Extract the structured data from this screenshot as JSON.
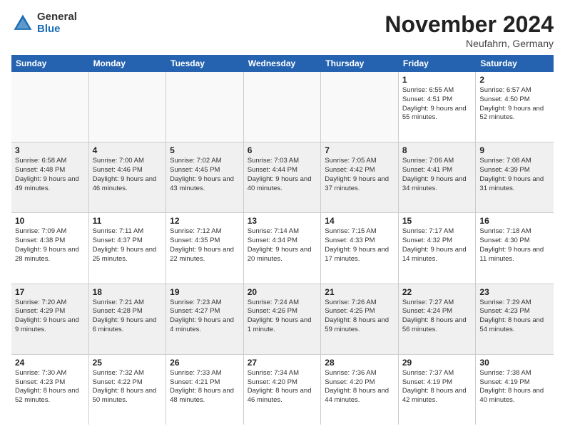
{
  "logo": {
    "general": "General",
    "blue": "Blue"
  },
  "title": "November 2024",
  "location": "Neufahrn, Germany",
  "header": {
    "days": [
      "Sunday",
      "Monday",
      "Tuesday",
      "Wednesday",
      "Thursday",
      "Friday",
      "Saturday"
    ]
  },
  "weeks": [
    [
      {
        "day": "",
        "info": "",
        "empty": true
      },
      {
        "day": "",
        "info": "",
        "empty": true
      },
      {
        "day": "",
        "info": "",
        "empty": true
      },
      {
        "day": "",
        "info": "",
        "empty": true
      },
      {
        "day": "",
        "info": "",
        "empty": true
      },
      {
        "day": "1",
        "info": "Sunrise: 6:55 AM\nSunset: 4:51 PM\nDaylight: 9 hours and 55 minutes."
      },
      {
        "day": "2",
        "info": "Sunrise: 6:57 AM\nSunset: 4:50 PM\nDaylight: 9 hours and 52 minutes."
      }
    ],
    [
      {
        "day": "3",
        "info": "Sunrise: 6:58 AM\nSunset: 4:48 PM\nDaylight: 9 hours and 49 minutes."
      },
      {
        "day": "4",
        "info": "Sunrise: 7:00 AM\nSunset: 4:46 PM\nDaylight: 9 hours and 46 minutes."
      },
      {
        "day": "5",
        "info": "Sunrise: 7:02 AM\nSunset: 4:45 PM\nDaylight: 9 hours and 43 minutes."
      },
      {
        "day": "6",
        "info": "Sunrise: 7:03 AM\nSunset: 4:44 PM\nDaylight: 9 hours and 40 minutes."
      },
      {
        "day": "7",
        "info": "Sunrise: 7:05 AM\nSunset: 4:42 PM\nDaylight: 9 hours and 37 minutes."
      },
      {
        "day": "8",
        "info": "Sunrise: 7:06 AM\nSunset: 4:41 PM\nDaylight: 9 hours and 34 minutes."
      },
      {
        "day": "9",
        "info": "Sunrise: 7:08 AM\nSunset: 4:39 PM\nDaylight: 9 hours and 31 minutes."
      }
    ],
    [
      {
        "day": "10",
        "info": "Sunrise: 7:09 AM\nSunset: 4:38 PM\nDaylight: 9 hours and 28 minutes."
      },
      {
        "day": "11",
        "info": "Sunrise: 7:11 AM\nSunset: 4:37 PM\nDaylight: 9 hours and 25 minutes."
      },
      {
        "day": "12",
        "info": "Sunrise: 7:12 AM\nSunset: 4:35 PM\nDaylight: 9 hours and 22 minutes."
      },
      {
        "day": "13",
        "info": "Sunrise: 7:14 AM\nSunset: 4:34 PM\nDaylight: 9 hours and 20 minutes."
      },
      {
        "day": "14",
        "info": "Sunrise: 7:15 AM\nSunset: 4:33 PM\nDaylight: 9 hours and 17 minutes."
      },
      {
        "day": "15",
        "info": "Sunrise: 7:17 AM\nSunset: 4:32 PM\nDaylight: 9 hours and 14 minutes."
      },
      {
        "day": "16",
        "info": "Sunrise: 7:18 AM\nSunset: 4:30 PM\nDaylight: 9 hours and 11 minutes."
      }
    ],
    [
      {
        "day": "17",
        "info": "Sunrise: 7:20 AM\nSunset: 4:29 PM\nDaylight: 9 hours and 9 minutes."
      },
      {
        "day": "18",
        "info": "Sunrise: 7:21 AM\nSunset: 4:28 PM\nDaylight: 9 hours and 6 minutes."
      },
      {
        "day": "19",
        "info": "Sunrise: 7:23 AM\nSunset: 4:27 PM\nDaylight: 9 hours and 4 minutes."
      },
      {
        "day": "20",
        "info": "Sunrise: 7:24 AM\nSunset: 4:26 PM\nDaylight: 9 hours and 1 minute."
      },
      {
        "day": "21",
        "info": "Sunrise: 7:26 AM\nSunset: 4:25 PM\nDaylight: 8 hours and 59 minutes."
      },
      {
        "day": "22",
        "info": "Sunrise: 7:27 AM\nSunset: 4:24 PM\nDaylight: 8 hours and 56 minutes."
      },
      {
        "day": "23",
        "info": "Sunrise: 7:29 AM\nSunset: 4:23 PM\nDaylight: 8 hours and 54 minutes."
      }
    ],
    [
      {
        "day": "24",
        "info": "Sunrise: 7:30 AM\nSunset: 4:23 PM\nDaylight: 8 hours and 52 minutes."
      },
      {
        "day": "25",
        "info": "Sunrise: 7:32 AM\nSunset: 4:22 PM\nDaylight: 8 hours and 50 minutes."
      },
      {
        "day": "26",
        "info": "Sunrise: 7:33 AM\nSunset: 4:21 PM\nDaylight: 8 hours and 48 minutes."
      },
      {
        "day": "27",
        "info": "Sunrise: 7:34 AM\nSunset: 4:20 PM\nDaylight: 8 hours and 46 minutes."
      },
      {
        "day": "28",
        "info": "Sunrise: 7:36 AM\nSunset: 4:20 PM\nDaylight: 8 hours and 44 minutes."
      },
      {
        "day": "29",
        "info": "Sunrise: 7:37 AM\nSunset: 4:19 PM\nDaylight: 8 hours and 42 minutes."
      },
      {
        "day": "30",
        "info": "Sunrise: 7:38 AM\nSunset: 4:19 PM\nDaylight: 8 hours and 40 minutes."
      }
    ]
  ]
}
